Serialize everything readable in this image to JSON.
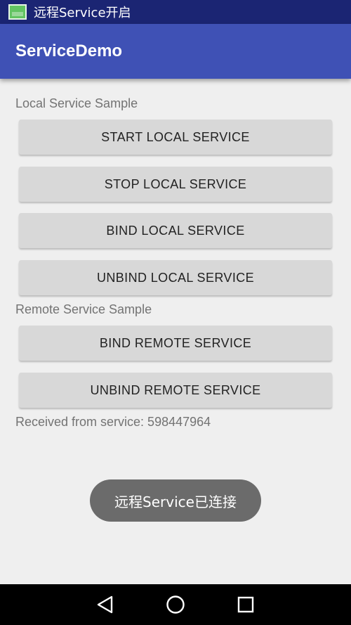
{
  "status_bar": {
    "notification_text": "远程Service开启",
    "notification_icon": "android-app-icon"
  },
  "app_bar": {
    "title": "ServiceDemo",
    "color": "#3f51b5"
  },
  "local_section": {
    "label": "Local Service Sample",
    "buttons": [
      {
        "label": "START LOCAL SERVICE"
      },
      {
        "label": "STOP LOCAL SERVICE"
      },
      {
        "label": "BIND LOCAL SERVICE"
      },
      {
        "label": "UNBIND LOCAL SERVICE"
      }
    ]
  },
  "remote_section": {
    "label": "Remote Service Sample",
    "buttons": [
      {
        "label": "BIND REMOTE SERVICE"
      },
      {
        "label": "UNBIND REMOTE SERVICE"
      }
    ]
  },
  "received": {
    "text": "Received from service: 598447964"
  },
  "toast": {
    "text": "远程Service已连接"
  },
  "nav_bar": {
    "back_icon": "back-triangle-icon",
    "home_icon": "home-circle-icon",
    "recents_icon": "recents-square-icon"
  }
}
